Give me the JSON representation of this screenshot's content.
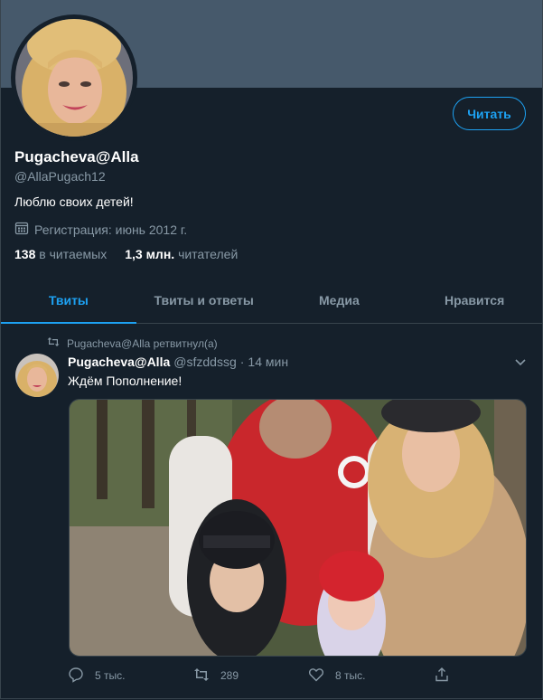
{
  "profile": {
    "follow_label": "Читать",
    "name": "Pugacheva@Alla",
    "handle": "@AllaPugach12",
    "bio": "Люблю своих детей!",
    "joined": "Регистрация: июнь 2012 г.",
    "following_count": "138",
    "following_label": "в читаемых",
    "followers_count": "1,3 млн.",
    "followers_label": "читателей"
  },
  "tabs": [
    {
      "label": "Твиты",
      "active": true
    },
    {
      "label": "Твиты и ответы"
    },
    {
      "label": "Медиа"
    },
    {
      "label": "Нравится"
    }
  ],
  "tweet": {
    "retweet_text": "Pugacheva@Alla ретвитнул(а)",
    "author_name": "Pugacheva@Alla",
    "author_handle": "@sfzddssg",
    "separator": "·",
    "time": "14 мин",
    "text": "Ждём Пополнение!",
    "replies": "5 тыс.",
    "retweets": "289",
    "likes": "8 тыс."
  },
  "colors": {
    "background": "#15202b",
    "accent": "#1da1f2",
    "muted": "#8899a6",
    "banner": "#46596b"
  }
}
